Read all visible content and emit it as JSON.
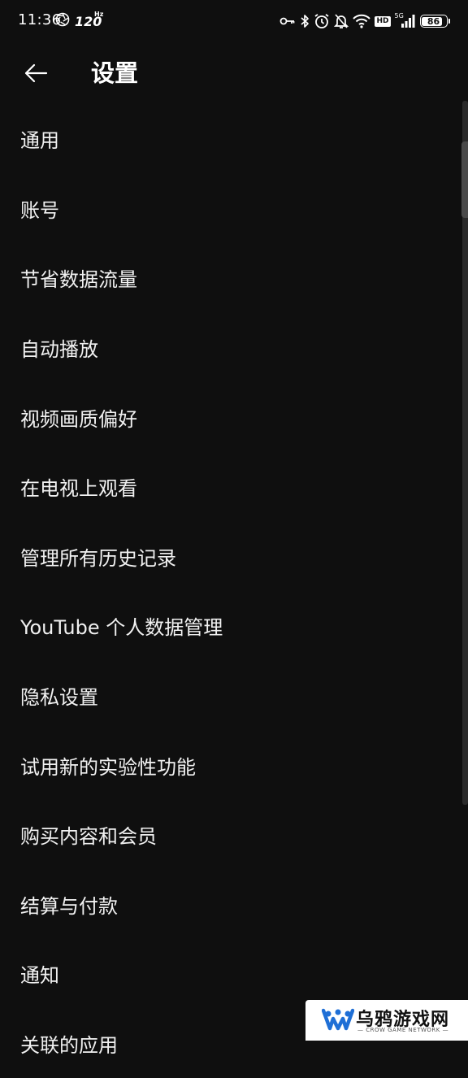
{
  "status_bar": {
    "time": "11:36",
    "refresh_rate": "120",
    "refresh_unit": "Hz",
    "network": "5G",
    "hd": "HD",
    "battery": "86",
    "battery_level": 0.86
  },
  "header": {
    "title": "设置"
  },
  "settings": {
    "items": [
      {
        "label": "通用"
      },
      {
        "label": "账号"
      },
      {
        "label": "节省数据流量"
      },
      {
        "label": "自动播放"
      },
      {
        "label": "视频画质偏好"
      },
      {
        "label": "在电视上观看"
      },
      {
        "label": "管理所有历史记录"
      },
      {
        "label": "YouTube 个人数据管理"
      },
      {
        "label": "隐私设置"
      },
      {
        "label": "试用新的实验性功能"
      },
      {
        "label": "购买内容和会员"
      },
      {
        "label": "结算与付款"
      },
      {
        "label": "通知"
      },
      {
        "label": "关联的应用"
      }
    ]
  },
  "watermark": {
    "title": "乌鸦游戏网",
    "subtitle": "— CROW GAME NETWORK —"
  },
  "colors": {
    "background": "#0f0f0f",
    "text": "#f1f1f1"
  }
}
